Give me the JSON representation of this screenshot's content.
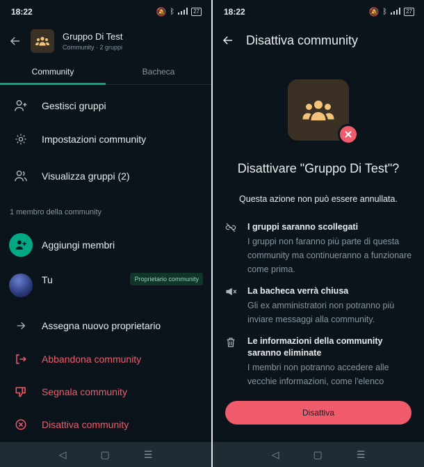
{
  "status": {
    "time": "18:22",
    "battery": "27"
  },
  "left": {
    "title": "Gruppo Di Test",
    "subtitle": "Community · 2 gruppi",
    "tabs": [
      "Community",
      "Bacheca"
    ],
    "menu": {
      "manage": "Gestisci gruppi",
      "settings": "Impostazioni community",
      "view": "Visualizza gruppi (2)"
    },
    "members_section": "1 membro della community",
    "add_members": "Aggiungi membri",
    "you": "Tu",
    "owner_badge": "Proprietario community",
    "actions": {
      "assign": "Assegna nuovo proprietario",
      "leave": "Abbandona community",
      "report": "Segnala community",
      "deactivate": "Disattiva community"
    }
  },
  "right": {
    "title": "Disattiva community",
    "question": "Disattivare \"Gruppo Di Test\"?",
    "subtitle": "Questa azione non può essere annullata.",
    "items": [
      {
        "heading": "I gruppi saranno scollegati",
        "desc": "I gruppi non faranno più parte di questa community ma continueranno a funzionare come prima."
      },
      {
        "heading": "La bacheca verrà chiusa",
        "desc": "Gli ex amministratori non potranno più inviare messaggi alla community."
      },
      {
        "heading": "Le informazioni della community saranno eliminate",
        "desc": "I membri non potranno accedere alle vecchie informazioni, come l'elenco"
      }
    ],
    "button": "Disattiva"
  },
  "colors": {
    "accent": "#00a884",
    "danger": "#f15c6d",
    "background": "#0b141a",
    "icon_bg": "#3a3024",
    "icon_fg": "#f3c37a"
  }
}
